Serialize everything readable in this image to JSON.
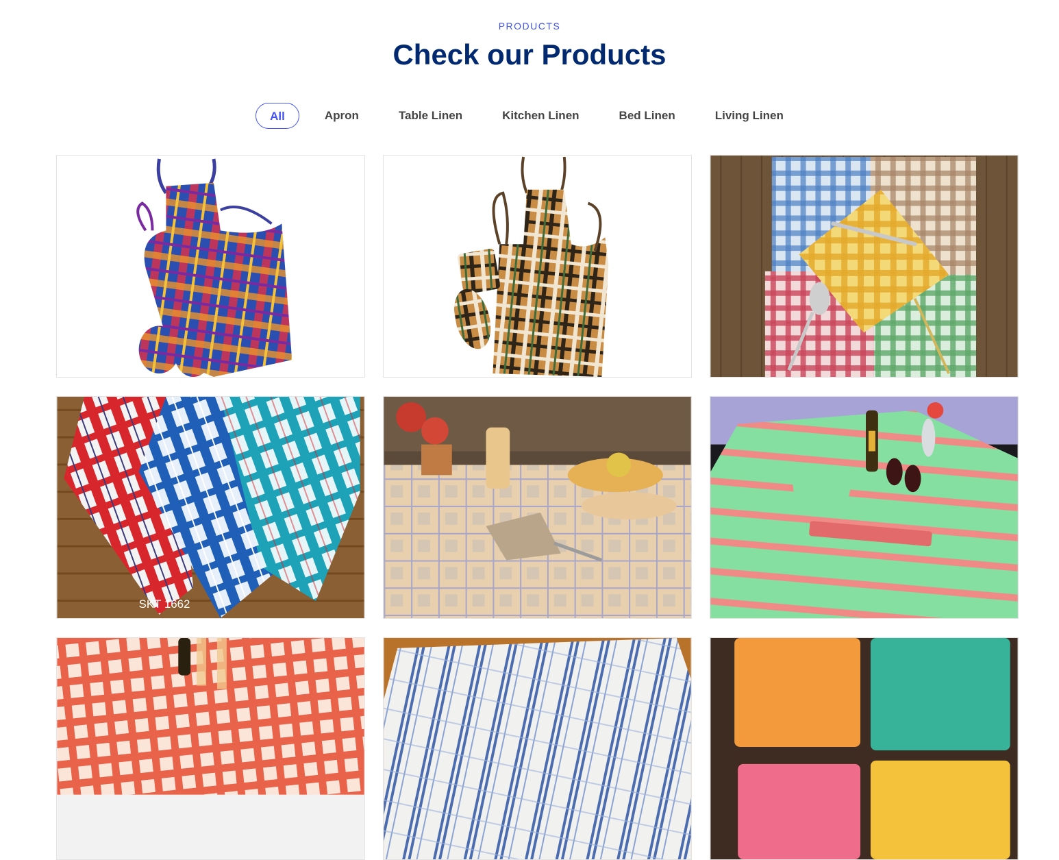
{
  "section": {
    "eyebrow": "PRODUCTS",
    "title": "Check our Products"
  },
  "filters": [
    {
      "label": "All",
      "active": true
    },
    {
      "label": "Apron",
      "active": false
    },
    {
      "label": "Table Linen",
      "active": false
    },
    {
      "label": "Kitchen Linen",
      "active": false
    },
    {
      "label": "Bed Linen",
      "active": false
    },
    {
      "label": "Living Linen",
      "active": false
    }
  ],
  "products": [
    {
      "image": "plaid-apron-with-oven-mitts"
    },
    {
      "image": "brown-plaid-apron-with-pot-holders"
    },
    {
      "image": "checked-napkins-with-cutlery"
    },
    {
      "image": "plaid-kitchen-towels",
      "caption": "SKT 1662"
    },
    {
      "image": "beige-tablecloth-with-fruit-bowl"
    },
    {
      "image": "green-striped-tablecloth-with-wine"
    },
    {
      "image": "red-checked-tablecloth"
    },
    {
      "image": "blue-striped-tea-towels"
    },
    {
      "image": "terry-cloth-squares"
    }
  ],
  "colors": {
    "accent": "#4154f1",
    "heading": "#012970"
  }
}
